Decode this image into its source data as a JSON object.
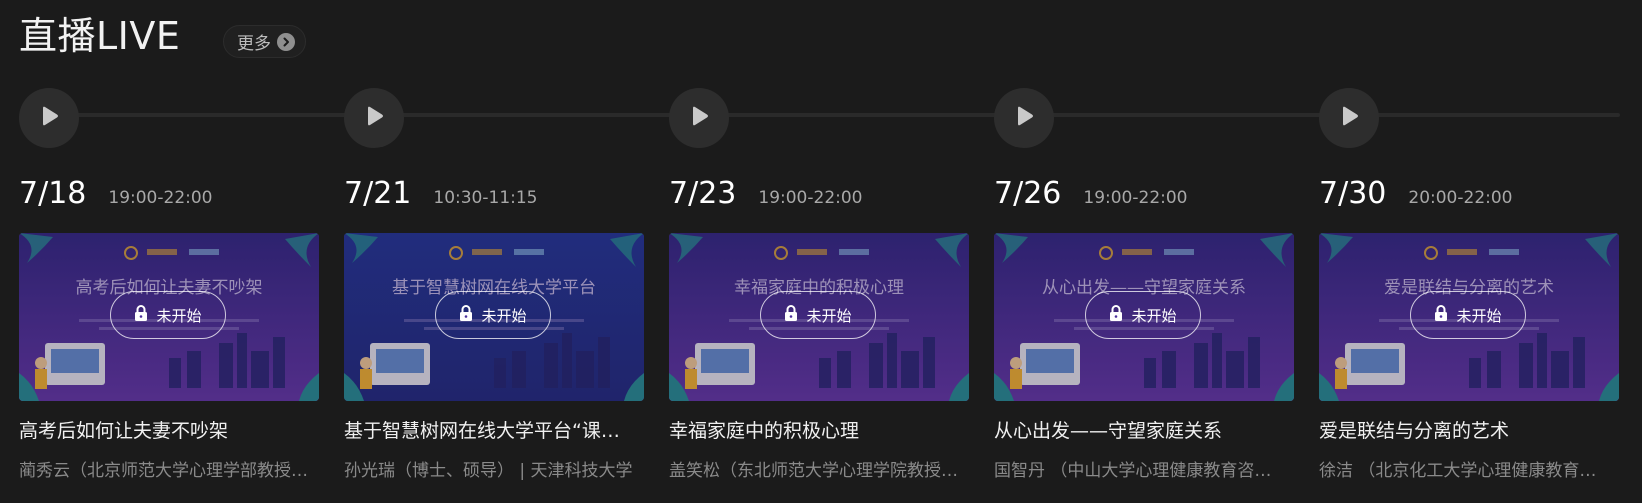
{
  "header": {
    "title": "直播LIVE",
    "more_label": "更多"
  },
  "icons": {
    "play": "play-icon",
    "lock": "lock-icon",
    "more": "chevron-right-icon"
  },
  "colors": {
    "background": "#1b1b1b",
    "node": "#2d2d2d",
    "poster": "#4a2f9c"
  },
  "items": [
    {
      "date": "7/18",
      "time": "19:00-22:00",
      "poster_title": "高考后如何让夫妻不吵架",
      "status": "未开始",
      "title": "高考后如何让夫妻不吵架",
      "subtitle": "蔺秀云（北京师范大学心理学部教授…"
    },
    {
      "date": "7/21",
      "time": "10:30-11:15",
      "poster_title": "基于智慧树网在线大学平台",
      "status": "未开始",
      "title": "基于智慧树网在线大学平台“课…",
      "subtitle": "孙光瑞（博士、硕导） | 天津科技大学"
    },
    {
      "date": "7/23",
      "time": "19:00-22:00",
      "poster_title": "幸福家庭中的积极心理",
      "status": "未开始",
      "title": "幸福家庭中的积极心理",
      "subtitle": "盖笑松（东北师范大学心理学院教授…"
    },
    {
      "date": "7/26",
      "time": "19:00-22:00",
      "poster_title": "从心出发——守望家庭关系",
      "status": "未开始",
      "title": "从心出发——守望家庭关系",
      "subtitle": "国智丹 （中山大学心理健康教育咨…"
    },
    {
      "date": "7/30",
      "time": "20:00-22:00",
      "poster_title": "爱是联结与分离的艺术",
      "status": "未开始",
      "title": "爱是联结与分离的艺术",
      "subtitle": "徐洁 （北京化工大学心理健康教育…"
    }
  ]
}
